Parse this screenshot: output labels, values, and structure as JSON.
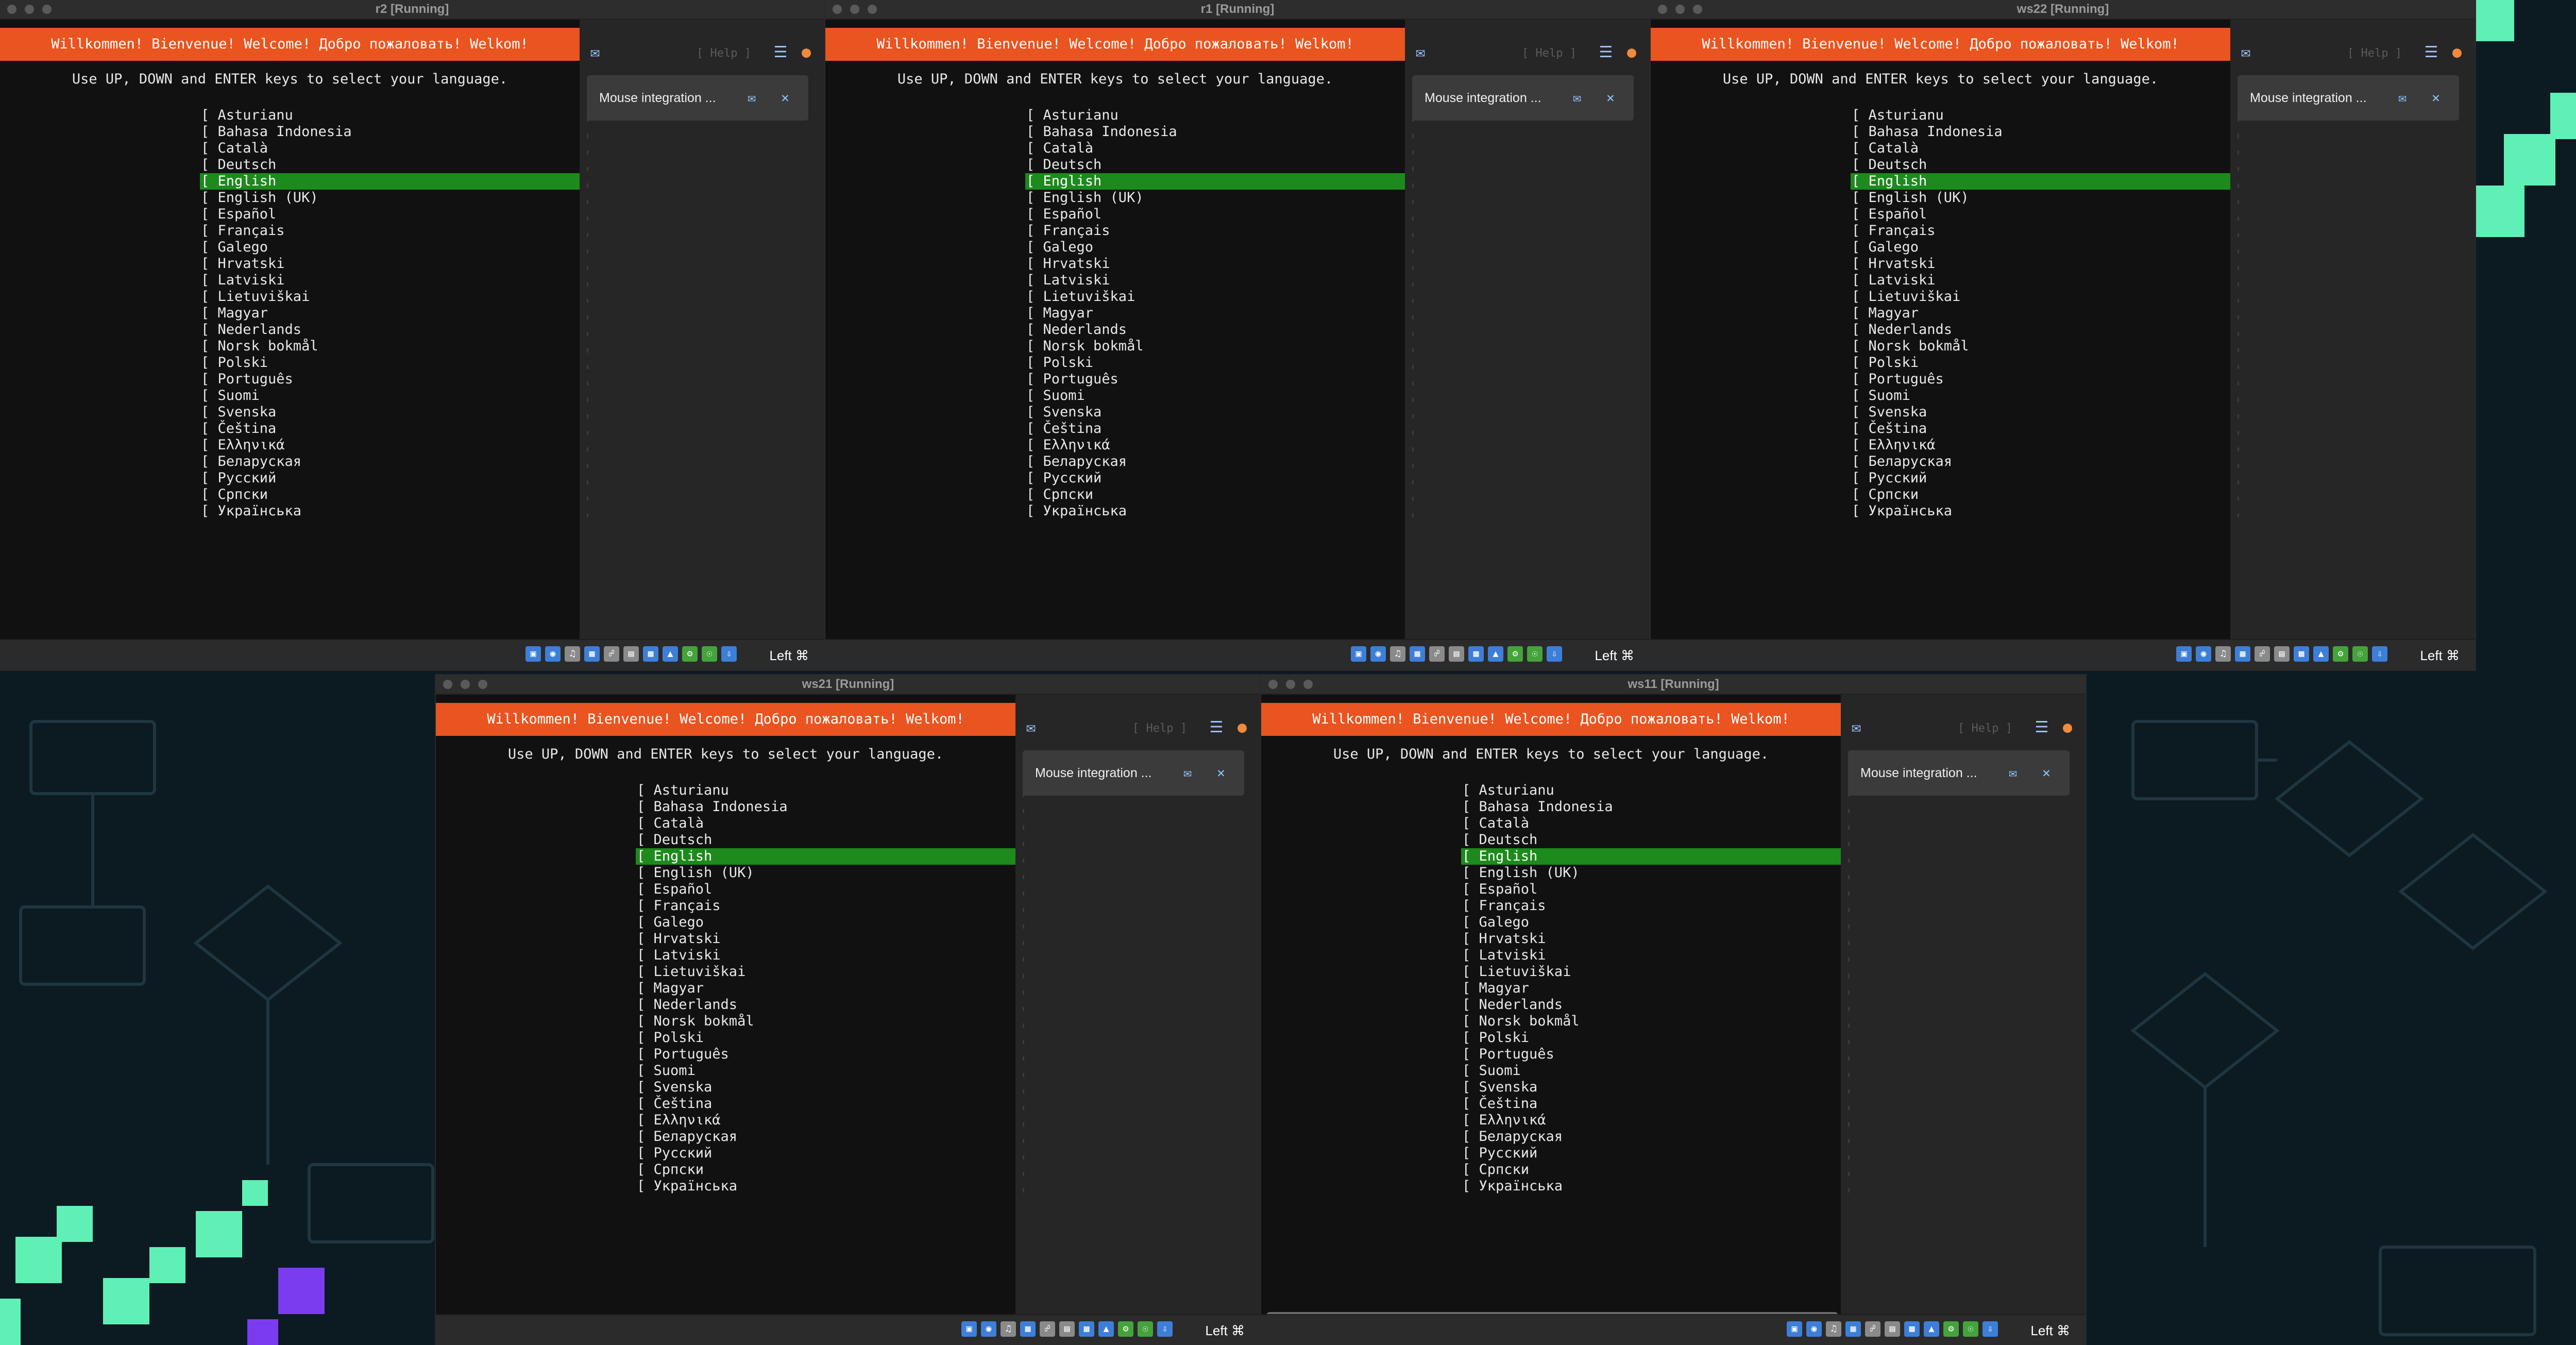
{
  "banner_text": "Willkommen! Bienvenue! Welcome! Добро пожаловать! Welkom!",
  "instruction_text": "Use UP, DOWN and ENTER keys to select your language.",
  "help_label": "[ Help ]",
  "mouse_notice": "Mouse integration ...",
  "host_key_label": "Left ⌘",
  "selected_language": "English",
  "languages": [
    "[ Asturianu",
    "[ Bahasa Indonesia",
    "[ Català",
    "[ Deutsch",
    "[ English",
    "[ English (UK)",
    "[ Español",
    "[ Français",
    "[ Galego",
    "[ Hrvatski",
    "[ Latviski",
    "[ Lietuviškai",
    "[ Magyar",
    "[ Nederlands",
    "[ Norsk bokmål",
    "[ Polski",
    "[ Português",
    "[ Suomi",
    "[ Svenska",
    "[ Čeština",
    "[ Ελληνικά",
    "[ Беларуская",
    "[ Русский",
    "[ Српски",
    "[ Українська"
  ],
  "windows": [
    {
      "id": "r2",
      "title": "r2 [Running]"
    },
    {
      "id": "r1",
      "title": "r1 [Running]"
    },
    {
      "id": "ws22",
      "title": "ws22 [Running]"
    },
    {
      "id": "ws21",
      "title": "ws21 [Running]"
    },
    {
      "id": "ws11",
      "title": "ws11 [Running]"
    }
  ],
  "colors": {
    "banner": "#e95420",
    "selection": "#1d8a1d",
    "desktop": "#0c1a22",
    "accent_green": "#5ff0b5",
    "accent_purple": "#7b3cf0"
  }
}
